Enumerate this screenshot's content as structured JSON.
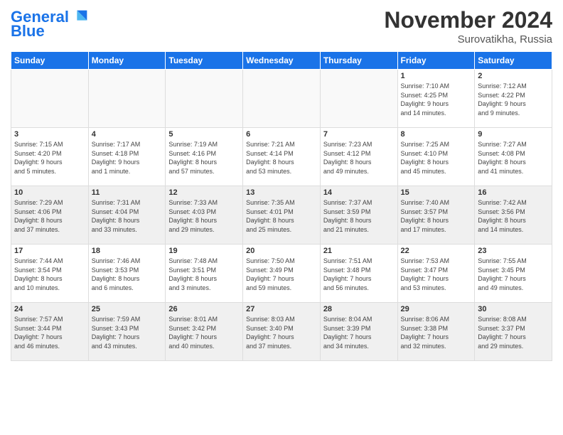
{
  "header": {
    "logo_line1": "General",
    "logo_line2": "Blue",
    "month": "November 2024",
    "location": "Surovatikha, Russia"
  },
  "days_of_week": [
    "Sunday",
    "Monday",
    "Tuesday",
    "Wednesday",
    "Thursday",
    "Friday",
    "Saturday"
  ],
  "weeks": [
    [
      {
        "day": "",
        "info": "",
        "empty": true
      },
      {
        "day": "",
        "info": "",
        "empty": true
      },
      {
        "day": "",
        "info": "",
        "empty": true
      },
      {
        "day": "",
        "info": "",
        "empty": true
      },
      {
        "day": "",
        "info": "",
        "empty": true
      },
      {
        "day": "1",
        "info": "Sunrise: 7:10 AM\nSunset: 4:25 PM\nDaylight: 9 hours\nand 14 minutes.",
        "empty": false
      },
      {
        "day": "2",
        "info": "Sunrise: 7:12 AM\nSunset: 4:22 PM\nDaylight: 9 hours\nand 9 minutes.",
        "empty": false
      }
    ],
    [
      {
        "day": "3",
        "info": "Sunrise: 7:15 AM\nSunset: 4:20 PM\nDaylight: 9 hours\nand 5 minutes.",
        "empty": false
      },
      {
        "day": "4",
        "info": "Sunrise: 7:17 AM\nSunset: 4:18 PM\nDaylight: 9 hours\nand 1 minute.",
        "empty": false
      },
      {
        "day": "5",
        "info": "Sunrise: 7:19 AM\nSunset: 4:16 PM\nDaylight: 8 hours\nand 57 minutes.",
        "empty": false
      },
      {
        "day": "6",
        "info": "Sunrise: 7:21 AM\nSunset: 4:14 PM\nDaylight: 8 hours\nand 53 minutes.",
        "empty": false
      },
      {
        "day": "7",
        "info": "Sunrise: 7:23 AM\nSunset: 4:12 PM\nDaylight: 8 hours\nand 49 minutes.",
        "empty": false
      },
      {
        "day": "8",
        "info": "Sunrise: 7:25 AM\nSunset: 4:10 PM\nDaylight: 8 hours\nand 45 minutes.",
        "empty": false
      },
      {
        "day": "9",
        "info": "Sunrise: 7:27 AM\nSunset: 4:08 PM\nDaylight: 8 hours\nand 41 minutes.",
        "empty": false
      }
    ],
    [
      {
        "day": "10",
        "info": "Sunrise: 7:29 AM\nSunset: 4:06 PM\nDaylight: 8 hours\nand 37 minutes.",
        "empty": false
      },
      {
        "day": "11",
        "info": "Sunrise: 7:31 AM\nSunset: 4:04 PM\nDaylight: 8 hours\nand 33 minutes.",
        "empty": false
      },
      {
        "day": "12",
        "info": "Sunrise: 7:33 AM\nSunset: 4:03 PM\nDaylight: 8 hours\nand 29 minutes.",
        "empty": false
      },
      {
        "day": "13",
        "info": "Sunrise: 7:35 AM\nSunset: 4:01 PM\nDaylight: 8 hours\nand 25 minutes.",
        "empty": false
      },
      {
        "day": "14",
        "info": "Sunrise: 7:37 AM\nSunset: 3:59 PM\nDaylight: 8 hours\nand 21 minutes.",
        "empty": false
      },
      {
        "day": "15",
        "info": "Sunrise: 7:40 AM\nSunset: 3:57 PM\nDaylight: 8 hours\nand 17 minutes.",
        "empty": false
      },
      {
        "day": "16",
        "info": "Sunrise: 7:42 AM\nSunset: 3:56 PM\nDaylight: 8 hours\nand 14 minutes.",
        "empty": false
      }
    ],
    [
      {
        "day": "17",
        "info": "Sunrise: 7:44 AM\nSunset: 3:54 PM\nDaylight: 8 hours\nand 10 minutes.",
        "empty": false
      },
      {
        "day": "18",
        "info": "Sunrise: 7:46 AM\nSunset: 3:53 PM\nDaylight: 8 hours\nand 6 minutes.",
        "empty": false
      },
      {
        "day": "19",
        "info": "Sunrise: 7:48 AM\nSunset: 3:51 PM\nDaylight: 8 hours\nand 3 minutes.",
        "empty": false
      },
      {
        "day": "20",
        "info": "Sunrise: 7:50 AM\nSunset: 3:49 PM\nDaylight: 7 hours\nand 59 minutes.",
        "empty": false
      },
      {
        "day": "21",
        "info": "Sunrise: 7:51 AM\nSunset: 3:48 PM\nDaylight: 7 hours\nand 56 minutes.",
        "empty": false
      },
      {
        "day": "22",
        "info": "Sunrise: 7:53 AM\nSunset: 3:47 PM\nDaylight: 7 hours\nand 53 minutes.",
        "empty": false
      },
      {
        "day": "23",
        "info": "Sunrise: 7:55 AM\nSunset: 3:45 PM\nDaylight: 7 hours\nand 49 minutes.",
        "empty": false
      }
    ],
    [
      {
        "day": "24",
        "info": "Sunrise: 7:57 AM\nSunset: 3:44 PM\nDaylight: 7 hours\nand 46 minutes.",
        "empty": false
      },
      {
        "day": "25",
        "info": "Sunrise: 7:59 AM\nSunset: 3:43 PM\nDaylight: 7 hours\nand 43 minutes.",
        "empty": false
      },
      {
        "day": "26",
        "info": "Sunrise: 8:01 AM\nSunset: 3:42 PM\nDaylight: 7 hours\nand 40 minutes.",
        "empty": false
      },
      {
        "day": "27",
        "info": "Sunrise: 8:03 AM\nSunset: 3:40 PM\nDaylight: 7 hours\nand 37 minutes.",
        "empty": false
      },
      {
        "day": "28",
        "info": "Sunrise: 8:04 AM\nSunset: 3:39 PM\nDaylight: 7 hours\nand 34 minutes.",
        "empty": false
      },
      {
        "day": "29",
        "info": "Sunrise: 8:06 AM\nSunset: 3:38 PM\nDaylight: 7 hours\nand 32 minutes.",
        "empty": false
      },
      {
        "day": "30",
        "info": "Sunrise: 8:08 AM\nSunset: 3:37 PM\nDaylight: 7 hours\nand 29 minutes.",
        "empty": false
      }
    ]
  ]
}
